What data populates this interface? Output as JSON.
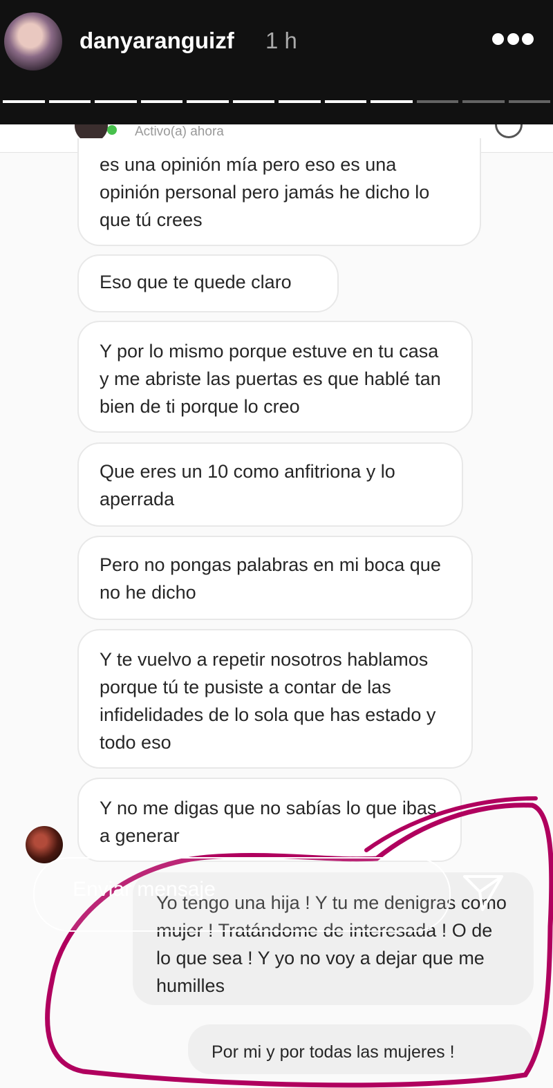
{
  "story": {
    "username": "danyaranguizf",
    "time": "1 h",
    "progress_segments": 12,
    "progress_done": 9
  },
  "chat": {
    "status": "Activo(a) ahora",
    "messages_received": [
      "es una opinión mía pero eso es una opinión personal pero jamás he dicho lo que tú crees",
      "Eso que te quede claro",
      "Y por lo mismo porque estuve en tu casa y me abriste las puertas es que hablé tan bien de ti porque lo creo",
      "Que eres un 10 como anfitriona y lo aperrada",
      "Pero no pongas palabras en mi boca que no he dicho",
      "Y te vuelvo a repetir nosotros hablamos porque tú te pusiste a contar de las infidelidades de lo sola que has estado y todo eso",
      "Y no me digas que no sabías lo que ibas a generar"
    ],
    "messages_sent": [
      "Yo tengo una hija ! Y tu me denigras como mujer ! Tratándome de interesada ! O de lo que sea ! Y yo no voy a dejar que me humilles",
      "Por mi y por todas las mujeres !"
    ]
  },
  "composer": {
    "placeholder": "Enviar mensaje"
  },
  "colors": {
    "annotation": "#b0005e",
    "online": "#47c04c"
  }
}
